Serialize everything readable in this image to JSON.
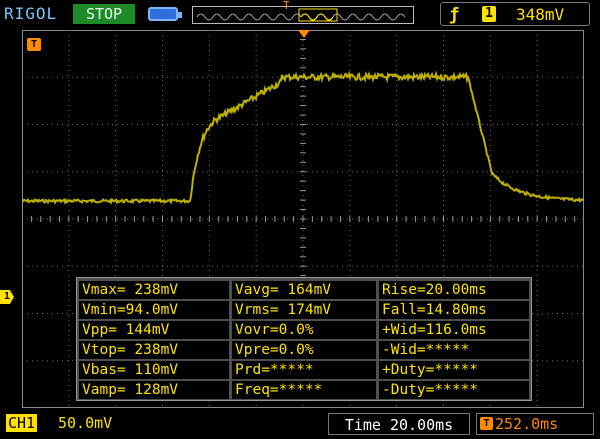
{
  "header": {
    "brand": "RIGOL",
    "run_state": "STOP",
    "memory_marker": "T",
    "trigger_slope_icon": "rising-edge-icon",
    "trigger_channel": "1",
    "trigger_level": "348mV"
  },
  "markers": {
    "trigger_tag": "T",
    "channel_tag": "1"
  },
  "measurements": {
    "rows": [
      {
        "c1": "Vmax= 238mV",
        "c2": "Vavg= 164mV",
        "c3": "Rise=20.00ms"
      },
      {
        "c1": "Vmin=94.0mV",
        "c2": "Vrms= 174mV",
        "c3": "Fall=14.80ms"
      },
      {
        "c1": "Vpp= 144mV",
        "c2": "Vovr=0.0%",
        "c3": "+Wid=116.0ms"
      },
      {
        "c1": "Vtop= 238mV",
        "c2": "Vpre=0.0%",
        "c3": "-Wid=*****"
      },
      {
        "c1": "Vbas= 110mV",
        "c2": "Prd=*****",
        "c3": "+Duty=*****"
      },
      {
        "c1": "Vamp= 128mV",
        "c2": "Freq=*****",
        "c3": "-Duty=*****"
      }
    ]
  },
  "footer": {
    "channel": "CH1",
    "channel_scale": "50.0mV",
    "timebase": "Time 20.00ms",
    "trigger_offset_tag": "T",
    "trigger_offset": "252.0ms"
  },
  "colors": {
    "trace": "#bdb000",
    "grid": "#6b6b6b",
    "accent_orange": "#ff8a00",
    "channel_yellow": "#ffe100"
  }
}
